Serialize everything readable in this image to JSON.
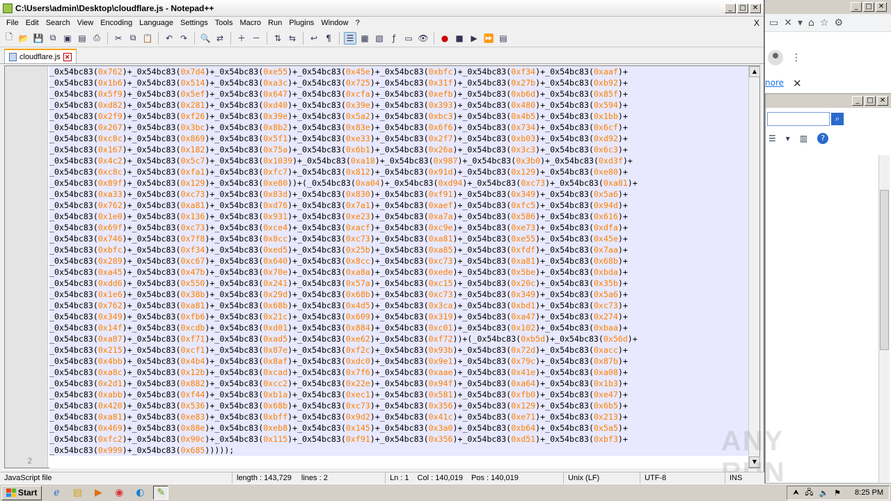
{
  "window": {
    "title": "C:\\Users\\admin\\Desktop\\cloudflare.js - Notepad++",
    "min": "_",
    "max": "□",
    "close": "✕"
  },
  "menu": [
    "File",
    "Edit",
    "Search",
    "View",
    "Encoding",
    "Language",
    "Settings",
    "Tools",
    "Macro",
    "Run",
    "Plugins",
    "Window",
    "?"
  ],
  "menu_close": "X",
  "tab": {
    "label": "cloudflare.js",
    "close": "✕"
  },
  "gutter": {
    "line2": "2"
  },
  "code_lines": [
    [
      "762",
      "7d4",
      "e55",
      "45e",
      "bfc",
      "f34",
      "aaf"
    ],
    [
      "1b6",
      "514",
      "a3c",
      "725",
      "31f",
      "27b",
      "b92"
    ],
    [
      "5f9",
      "5ef",
      "647",
      "cfa",
      "efb",
      "b6d",
      "85f"
    ],
    [
      "d82",
      "281",
      "d40",
      "39e",
      "393",
      "480",
      "594"
    ],
    [
      "2f9",
      "f26",
      "39e",
      "5a2",
      "bc3",
      "4b5",
      "1bb"
    ],
    [
      "267",
      "3bc",
      "8b2",
      "83e",
      "6f6",
      "734",
      "6cf"
    ],
    [
      "c8c",
      "869",
      "5f1",
      "e33",
      "2f7",
      "b03",
      "d92"
    ],
    [
      "167",
      "182",
      "75a",
      "6b1",
      "26a",
      "3c3",
      "6c3"
    ],
    [
      "4c2",
      "5c7",
      "1039",
      "a18",
      "987",
      "3b0",
      "d3f"
    ],
    [
      "c8c",
      "fa1",
      "fc7",
      "812",
      "91d",
      "129",
      "e80"
    ],
    [
      "89f",
      "129",
      "e80",
      "a04",
      "d94",
      "c73",
      "a81"
    ],
    [
      "a33",
      "c73",
      "83d",
      "830",
      "f91",
      "349",
      "5a6"
    ],
    [
      "762",
      "a81",
      "d76",
      "7a1",
      "aef",
      "fc5",
      "94d"
    ],
    [
      "1e0",
      "136",
      "931",
      "e23",
      "a7a",
      "586",
      "616"
    ],
    [
      "69f",
      "c73",
      "ce4",
      "acf",
      "c9e",
      "e73",
      "dfa"
    ],
    [
      "746",
      "7f8",
      "8cc",
      "c73",
      "a81",
      "e55",
      "45e"
    ],
    [
      "bfc",
      "f34",
      "ed5",
      "25b",
      "a85",
      "fdf",
      "7aa"
    ],
    [
      "289",
      "c67",
      "640",
      "8cc",
      "c73",
      "a81",
      "68b"
    ],
    [
      "a45",
      "47b",
      "70e",
      "a8a",
      "ede",
      "5be",
      "bda"
    ],
    [
      "dd6",
      "550",
      "241",
      "57a",
      "c15",
      "20c",
      "35b"
    ],
    [
      "1e6",
      "38b",
      "29d",
      "68b",
      "c73",
      "349",
      "5a6"
    ],
    [
      "762",
      "a81",
      "68b",
      "4d5",
      "3ca",
      "bd1",
      "c73"
    ],
    [
      "349",
      "fb6",
      "21c",
      "609",
      "319",
      "a47",
      "274"
    ],
    [
      "14f",
      "cdb",
      "d01",
      "884",
      "c01",
      "102",
      "baa"
    ],
    [
      "a87",
      "f71",
      "ad5",
      "e62",
      "f72",
      "b5d",
      "56d"
    ],
    [
      "215",
      "cf1",
      "87e",
      "f2c",
      "93b",
      "72d",
      "acc"
    ],
    [
      "4bb",
      "4b4",
      "8af",
      "dc0",
      "9e1",
      "79c",
      "87b"
    ],
    [
      "a8c",
      "12b",
      "cad",
      "7f6",
      "aae",
      "41e",
      "a08"
    ],
    [
      "2d1",
      "882",
      "cc2",
      "22e",
      "94f",
      "a64",
      "1b3"
    ],
    [
      "abb",
      "f44",
      "b1a",
      "ec1",
      "581",
      "fb0",
      "e47"
    ],
    [
      "420",
      "536",
      "68b",
      "c73",
      "356",
      "129",
      "6b5"
    ],
    [
      "a81",
      "e83",
      "bff",
      "9d2",
      "41c",
      "e71",
      "213"
    ],
    [
      "469",
      "88e",
      "eb8",
      "145",
      "3a0",
      "b64",
      "5a5"
    ],
    [
      "fc2",
      "90c",
      "115",
      "f91",
      "356",
      "d51",
      "bf3"
    ]
  ],
  "code_line_special": {
    "8": "_0x54bc83(0x4c2)+_0x54bc83(0x5c7)+_0x54bc83(0x1039)+_0x54bc83(0xa18)+_0x54bc83(0x987)+_0x54bc83(0x3b0)+_0x54bc83(0xd3f)+",
    "10": "_0x54bc83(0x89f)+_0x54bc83(0x129)+_0x54bc83(0xe80))+(_0x54bc83(0xa04)+_0x54bc83(0xd94)+_0x54bc83(0xc73)+_0x54bc83(0xa81)+",
    "24": "_0x54bc83(0xa87)+_0x54bc83(0xf71)+_0x54bc83(0xad5)+_0x54bc83(0xe62)+_0x54bc83(0xf72))+(_0x54bc83(0xb5d)+_0x54bc83(0x56d)+"
  },
  "code_last": "_0x54bc83(0x999)+_0x54bc83(0x685)))));",
  "status": {
    "type": "JavaScript file",
    "length": "length : 143,729",
    "lines": "lines : 2",
    "ln": "Ln : 1",
    "col": "Col : 140,019",
    "pos": "Pos : 140,019",
    "eol": "Unix (LF)",
    "enc": "UTF-8",
    "mode": "INS"
  },
  "bg_browser": {
    "more_link": "nore",
    "close": "✕"
  },
  "taskbar": {
    "start": "Start",
    "time": "8:25 PM"
  },
  "watermark": "ANY RUN",
  "colors": {
    "hex_literal": "#ff8000",
    "selection_bg": "#e8e8ff",
    "tab_accent": "#f4a400"
  }
}
